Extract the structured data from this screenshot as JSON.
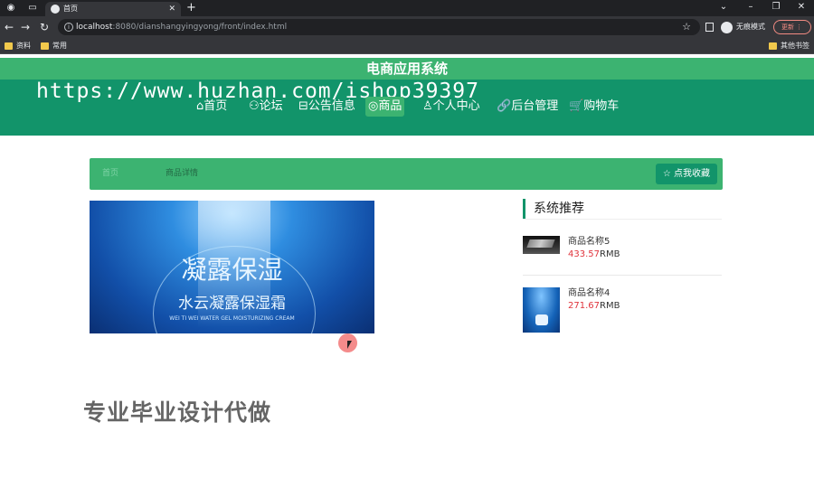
{
  "browser": {
    "tab_title": "首页",
    "url_host": "localhost",
    "url_rest": ":8080/dianshangyingyong/front/index.html",
    "profile_label": "无痕模式",
    "update_label": "更新",
    "bookmarks": [
      "资料",
      "常用"
    ],
    "other_bookmarks": "其他书签"
  },
  "site": {
    "title": "电商应用系统",
    "watermark": "https://www.huzhan.com/ishop39397",
    "menu": [
      {
        "icon": "⌂",
        "label": "首页"
      },
      {
        "icon": "⚇",
        "label": "论坛"
      },
      {
        "icon": "⊟",
        "label": "公告信息"
      },
      {
        "icon": "◎",
        "label": "商品"
      },
      {
        "icon": "♙",
        "label": "个人中心"
      },
      {
        "icon": "🔗",
        "label": "后台管理"
      },
      {
        "icon": "🛒",
        "label": "购物车"
      }
    ]
  },
  "breadcrumb": {
    "first": "首页",
    "second": "商品详情",
    "favorite_button": "点我收藏"
  },
  "product_image": {
    "headline": "凝露保湿",
    "subline": "水云凝露保湿霜",
    "caption": "WEI TI WEI WATER GEL MOISTURIZING CREAM"
  },
  "recommend": {
    "title": "系统推荐",
    "items": [
      {
        "name": "商品名称5",
        "price": "433.57",
        "unit": "RMB"
      },
      {
        "name": "商品名称4",
        "price": "271.67",
        "unit": "RMB"
      }
    ]
  },
  "overlay_text": "专业毕业设计代做"
}
